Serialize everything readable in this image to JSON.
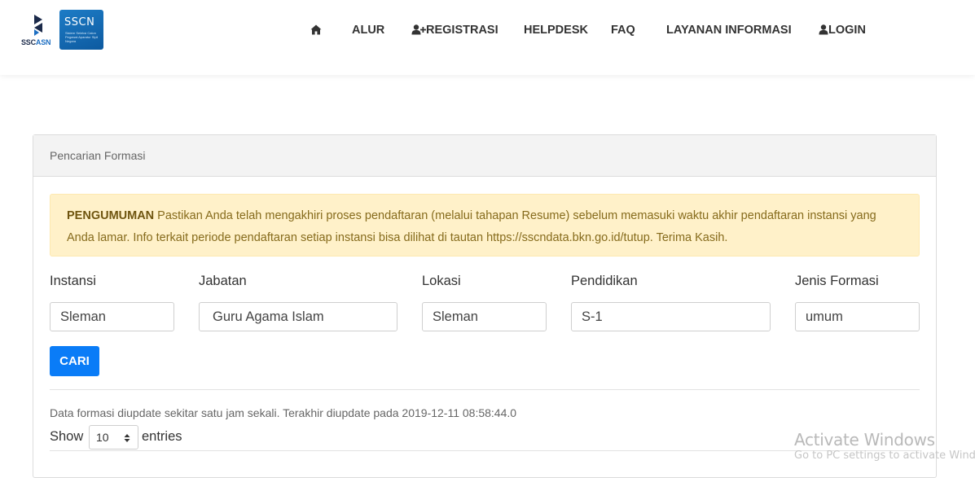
{
  "header": {
    "logo_left_text_a": "SSC",
    "logo_left_text_b": "ASN",
    "logo_right_text": "SSCN",
    "logo_right_small": "Sistem Seleksi Calon Pegawai Aparatur Sipil Negara",
    "nav": [
      {
        "label": "",
        "icon": "home-icon"
      },
      {
        "label": "ALUR"
      },
      {
        "label": "REGISTRASI",
        "icon": "user-plus-icon"
      },
      {
        "label": "HELPDESK"
      },
      {
        "label": "FAQ"
      },
      {
        "label": "LAYANAN INFORMASI"
      },
      {
        "label": "LOGIN",
        "icon": "user-icon"
      }
    ]
  },
  "card": {
    "title": "Pencarian Formasi",
    "alert": {
      "strong": "PENGUMUMAN",
      "text": " Pastikan Anda telah mengakhiri proses pendaftaran (melalui tahapan Resume) sebelum memasuki waktu akhir pendaftaran instansi yang Anda lamar. Info terkait periode pendaftaran setiap instansi bisa dilihat di tautan https://sscndata.bkn.go.id/tutup. Terima Kasih."
    },
    "fields": [
      {
        "label": "Instansi",
        "value": "Sleman"
      },
      {
        "label": "Jabatan",
        "value": "Guru Agama Islam"
      },
      {
        "label": "Lokasi",
        "value": "Sleman"
      },
      {
        "label": "Pendidikan",
        "value": "S-1"
      },
      {
        "label": "Jenis Formasi",
        "value": "umum"
      }
    ],
    "search_button": "CARI",
    "update_note": "Data formasi diupdate sekitar satu jam sekali. Terakhir diupdate pada 2019-12-11 08:58:44.0",
    "show_label": "Show",
    "entries_value": "10",
    "entries_label": "entries"
  },
  "watermark": {
    "title": "Activate Windows",
    "subtitle": "Go to PC settings to activate Windows."
  },
  "colors": {
    "primary_button": "#0a7cf7",
    "alert_bg": "#fff1c9",
    "alert_text": "#866b1c"
  }
}
